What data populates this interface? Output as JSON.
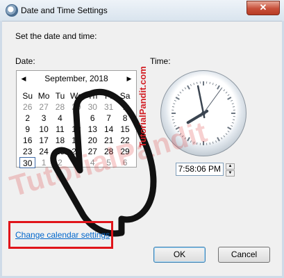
{
  "window": {
    "title": "Date and Time Settings",
    "close_glyph": "✕",
    "icon": "clock-icon"
  },
  "instruction": "Set the date and time:",
  "date_label": "Date:",
  "time_label": "Time:",
  "calendar": {
    "prev_glyph": "◀",
    "next_glyph": "▶",
    "month_title": "September, 2018",
    "weekdays": [
      "Su",
      "Mo",
      "Tu",
      "We",
      "Th",
      "Fr",
      "Sa"
    ],
    "weeks": [
      [
        {
          "d": "26",
          "o": true
        },
        {
          "d": "27",
          "o": true
        },
        {
          "d": "28",
          "o": true
        },
        {
          "d": "29",
          "o": true
        },
        {
          "d": "30",
          "o": true
        },
        {
          "d": "31",
          "o": true
        },
        {
          "d": "1"
        }
      ],
      [
        {
          "d": "2"
        },
        {
          "d": "3"
        },
        {
          "d": "4"
        },
        {
          "d": "5"
        },
        {
          "d": "6"
        },
        {
          "d": "7"
        },
        {
          "d": "8"
        }
      ],
      [
        {
          "d": "9"
        },
        {
          "d": "10"
        },
        {
          "d": "11"
        },
        {
          "d": "12"
        },
        {
          "d": "13"
        },
        {
          "d": "14"
        },
        {
          "d": "15"
        }
      ],
      [
        {
          "d": "16"
        },
        {
          "d": "17"
        },
        {
          "d": "18"
        },
        {
          "d": "19"
        },
        {
          "d": "20"
        },
        {
          "d": "21"
        },
        {
          "d": "22"
        }
      ],
      [
        {
          "d": "23"
        },
        {
          "d": "24"
        },
        {
          "d": "25"
        },
        {
          "d": "26"
        },
        {
          "d": "27"
        },
        {
          "d": "28"
        },
        {
          "d": "29"
        }
      ],
      [
        {
          "d": "30",
          "sel": true
        },
        {
          "d": "1",
          "o": true
        },
        {
          "d": "2",
          "o": true
        },
        {
          "d": "3",
          "o": true
        },
        {
          "d": "4",
          "o": true
        },
        {
          "d": "5",
          "o": true
        },
        {
          "d": "6",
          "o": true
        }
      ]
    ]
  },
  "clock": {
    "hour": 7,
    "minute": 58,
    "second": 6
  },
  "time_value": "7:58:06 PM",
  "spinner": {
    "up_glyph": "▲",
    "down_glyph": "▼"
  },
  "change_calendar_link": "Change calendar settings",
  "buttons": {
    "ok": "OK",
    "cancel": "Cancel"
  },
  "watermark": {
    "text": "TutorialPandit",
    "logo_text": "TutorialPandit.com"
  },
  "colors": {
    "link": "#0066cc",
    "highlight_border": "#e0141a",
    "watermark": "#d21e24"
  }
}
